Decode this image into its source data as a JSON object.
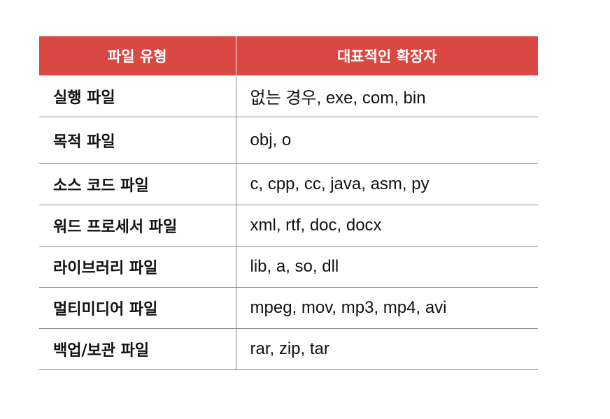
{
  "table": {
    "headers": {
      "file_type": "파일 유형",
      "extensions": "대표적인 확장자"
    },
    "rows": [
      {
        "type": "실행 파일",
        "extensions": "없는 경우, exe, com, bin"
      },
      {
        "type": "목적 파일",
        "extensions": "obj, o"
      },
      {
        "type": "소스 코드 파일",
        "extensions": "c, cpp, cc, java, asm, py"
      },
      {
        "type": "워드 프로세서 파일",
        "extensions": "xml, rtf, doc, docx"
      },
      {
        "type": "라이브러리 파일",
        "extensions": "lib, a, so, dll"
      },
      {
        "type": "멀티미디어 파일",
        "extensions": "mpeg, mov, mp3, mp4, avi"
      },
      {
        "type": "백업/보관 파일",
        "extensions": "rar, zip, tar"
      }
    ]
  },
  "colors": {
    "header_bg": "#d94843",
    "header_text": "#ffffff",
    "border": "#8a8a8a",
    "text": "#111111"
  }
}
